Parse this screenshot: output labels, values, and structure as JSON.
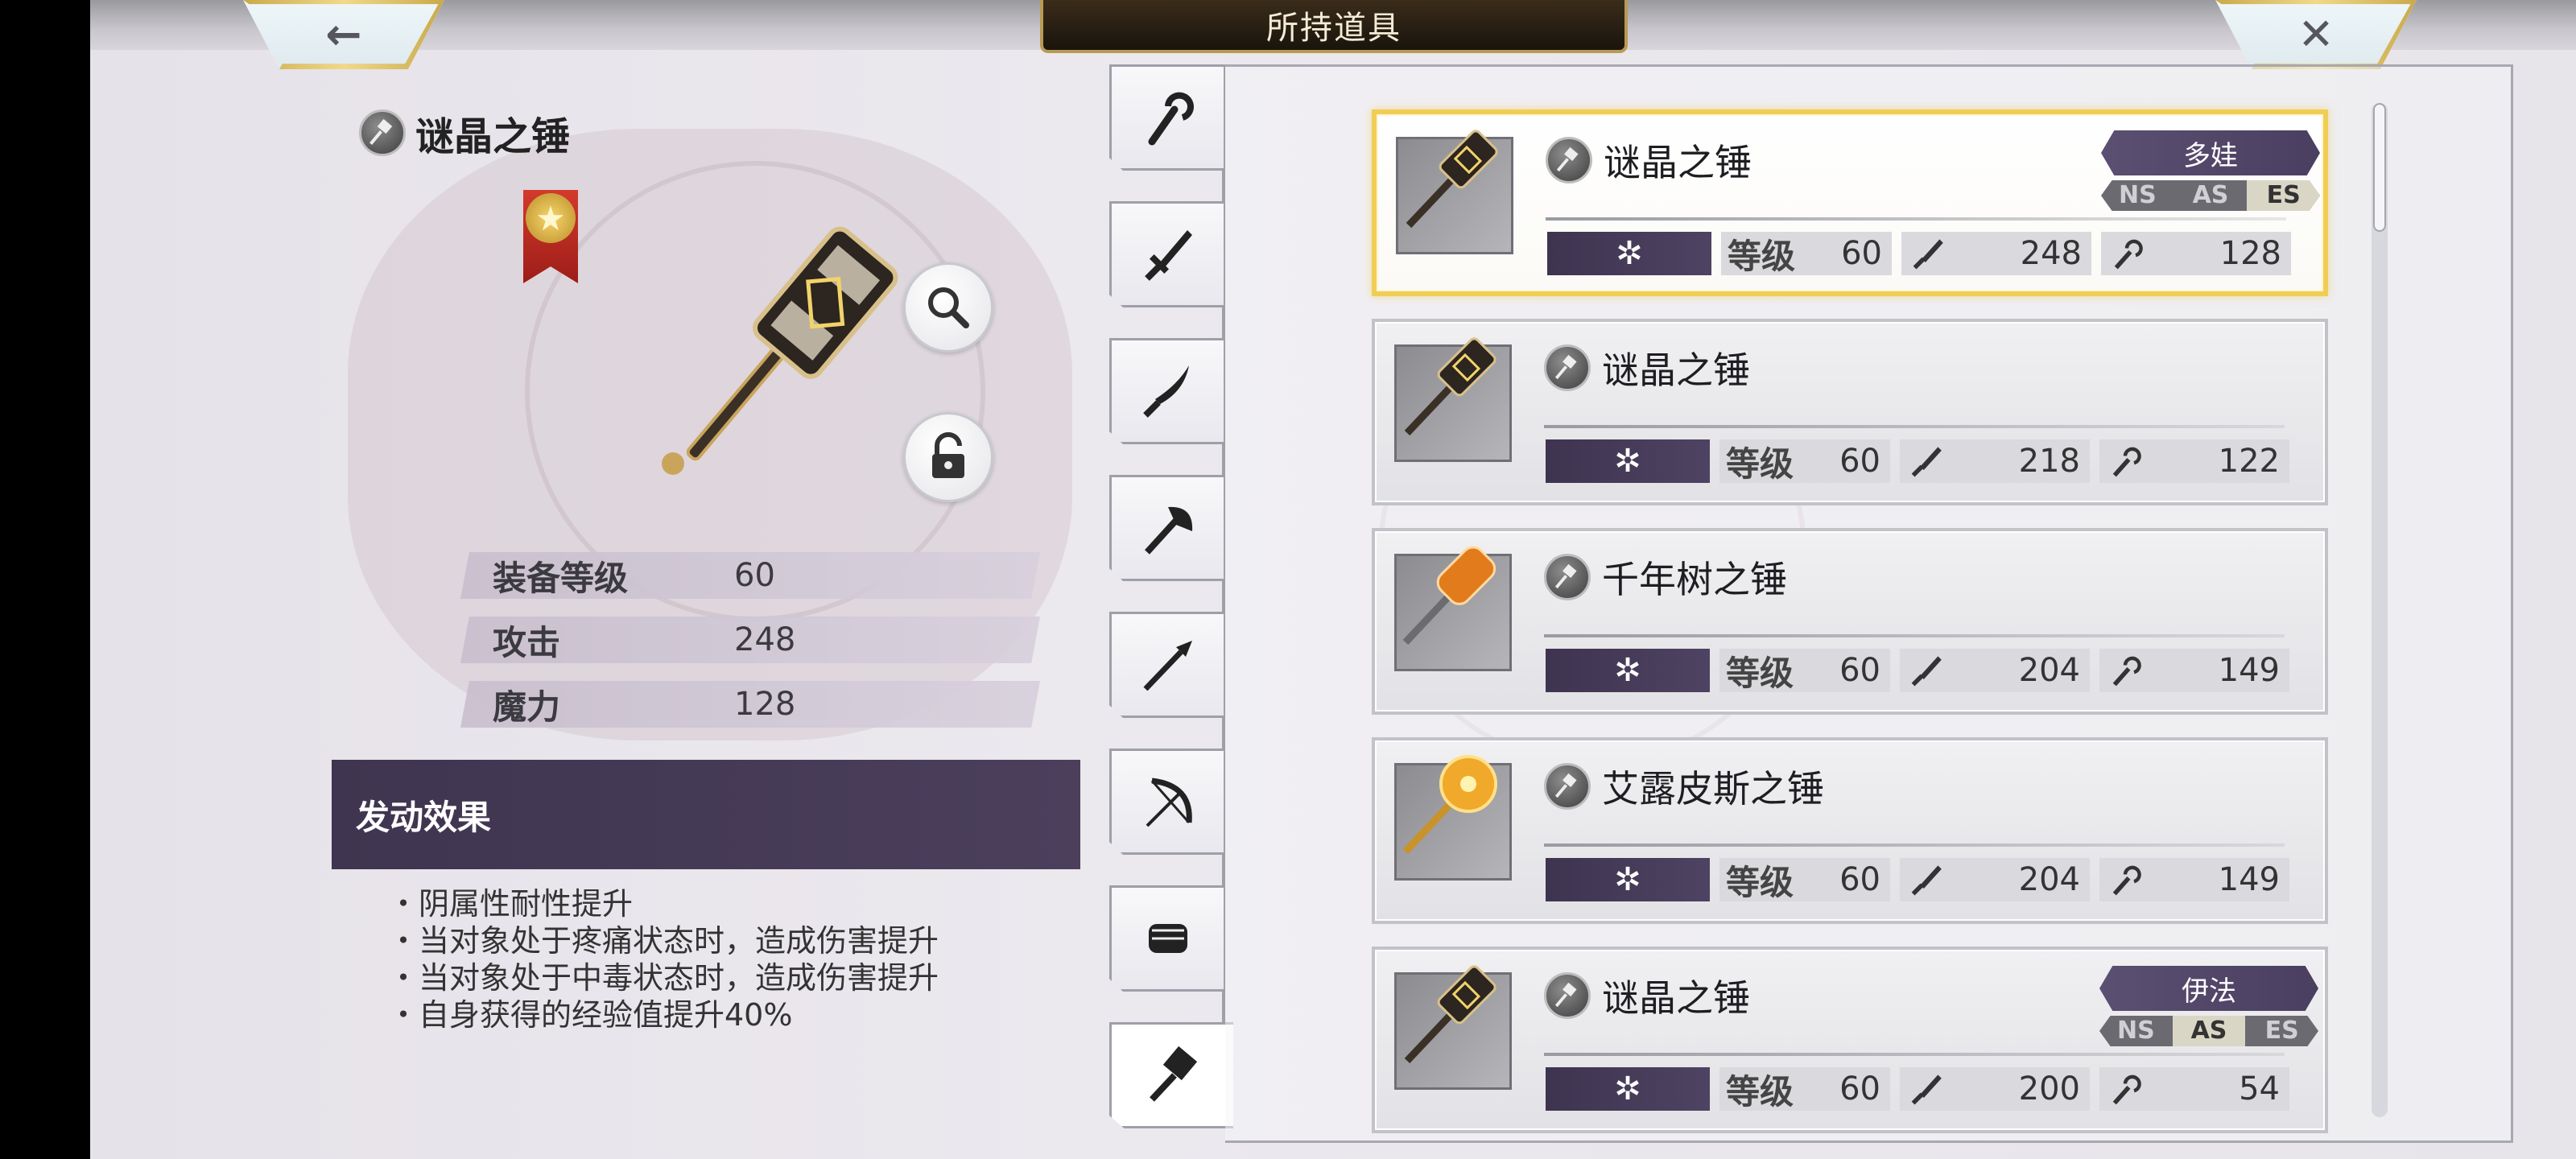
{
  "header": {
    "title": "所持道具"
  },
  "nav": {
    "back_glyph": "←",
    "close_glyph": "✕"
  },
  "detail": {
    "name": "谜晶之锤",
    "stats": [
      {
        "label": "装备等级",
        "value": "60"
      },
      {
        "label": "攻击",
        "value": "248"
      },
      {
        "label": "魔力",
        "value": "128"
      }
    ],
    "effect_header": "发动效果",
    "effects": [
      "・阴属性耐性提升",
      "・当对象处于疼痛状态时，造成伤害提升",
      "・当对象处于中毒状态时，造成伤害提升",
      "・自身获得的经验值提升40%"
    ]
  },
  "tabs": [
    "staff-icon",
    "sword-icon",
    "katana-icon",
    "axe-icon",
    "spear-icon",
    "bow-icon",
    "fist-icon",
    "hammer-icon"
  ],
  "list": {
    "level_label": "等级",
    "rarity_glyph": "✲",
    "items": [
      {
        "name": "谜晶之锤",
        "level": "60",
        "atk": "248",
        "mag": "128",
        "character": "多娃",
        "ns": [
          "NS",
          "AS",
          "ES"
        ],
        "ns_active": 2,
        "art": "dark"
      },
      {
        "name": "谜晶之锤",
        "level": "60",
        "atk": "218",
        "mag": "122",
        "character": "",
        "ns": [],
        "ns_active": -1,
        "art": "dark"
      },
      {
        "name": "千年树之锤",
        "level": "60",
        "atk": "204",
        "mag": "149",
        "character": "",
        "ns": [],
        "ns_active": -1,
        "art": "orange"
      },
      {
        "name": "艾露皮斯之锤",
        "level": "60",
        "atk": "204",
        "mag": "149",
        "character": "",
        "ns": [],
        "ns_active": -1,
        "art": "gold"
      },
      {
        "name": "谜晶之锤",
        "level": "60",
        "atk": "200",
        "mag": "54",
        "character": "伊法",
        "ns": [
          "NS",
          "AS",
          "ES"
        ],
        "ns_active": 1,
        "art": "dark"
      }
    ]
  }
}
